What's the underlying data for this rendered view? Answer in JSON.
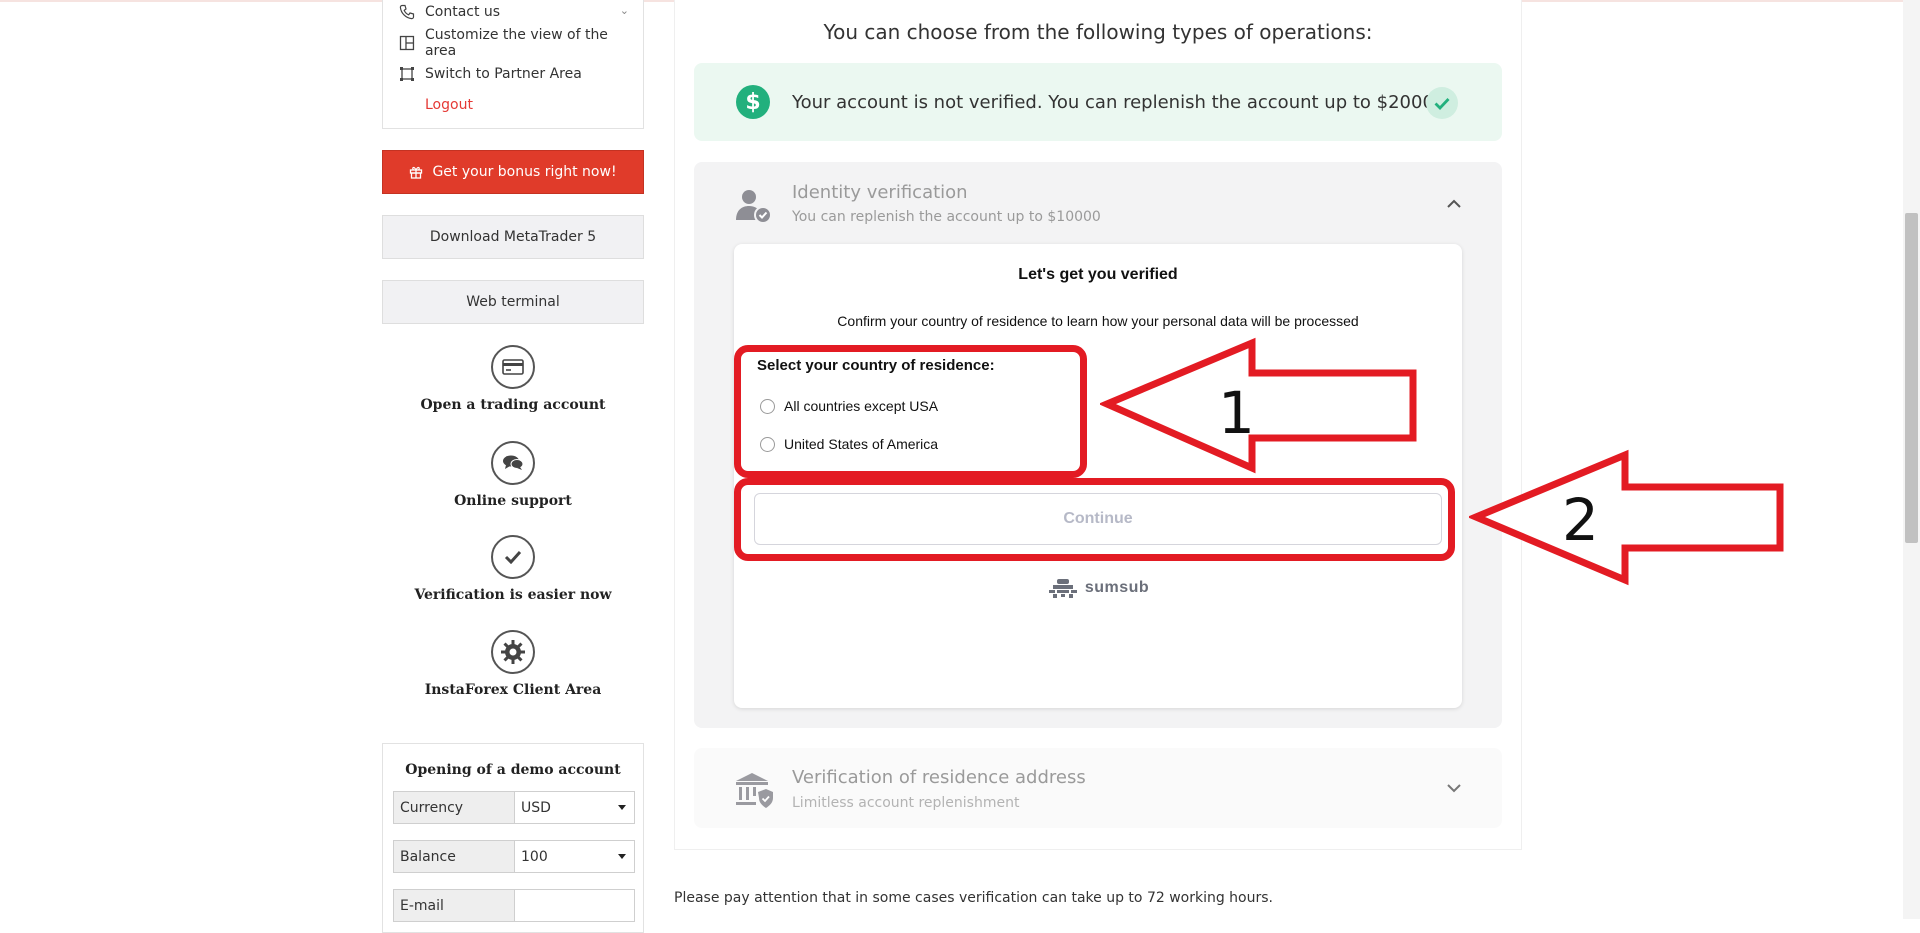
{
  "sidebar": {
    "menu": {
      "contact": "Contact us",
      "customize": "Customize the view of the area",
      "partner": "Switch to Partner Area",
      "logout": "Logout"
    },
    "bonus_button": "Get your bonus right now!",
    "download_button": "Download MetaTrader 5",
    "web_terminal_button": "Web terminal",
    "links": {
      "open_account": "Open a trading account",
      "online_support": "Online support",
      "verification": "Verification is easier now",
      "client_area": "InstaForex Client Area"
    },
    "demo": {
      "title": "Opening of a demo account",
      "currency_label": "Currency",
      "currency_value": "USD",
      "balance_label": "Balance",
      "balance_value": "100",
      "email_label": "E-mail",
      "email_value": ""
    }
  },
  "main": {
    "title": "You can choose from the following types of operations:",
    "unverified": {
      "text": "Your account is not verified. You can replenish the account up to $2000"
    },
    "identity": {
      "title": "Identity verification",
      "subtitle": "You can replenish the account up to $10000"
    },
    "verify_card": {
      "title": "Let's get you verified",
      "subtitle": "Confirm your country of residence to learn how your personal data will be processed",
      "select_label": "Select your country of residence:",
      "options": [
        "All countries except USA",
        "United States of America"
      ],
      "continue": "Continue",
      "brand": "sumsub"
    },
    "address": {
      "title": "Verification of residence address",
      "subtitle": "Limitless account replenishment"
    },
    "notice": "Please pay attention that in some cases verification can take up to 72 working hours."
  },
  "annotations": {
    "arrow_1": "1",
    "arrow_2": "2"
  },
  "colors": {
    "accent_red": "#e03b2a",
    "annotation_red": "#e31b23",
    "success_green": "#22b07d"
  }
}
